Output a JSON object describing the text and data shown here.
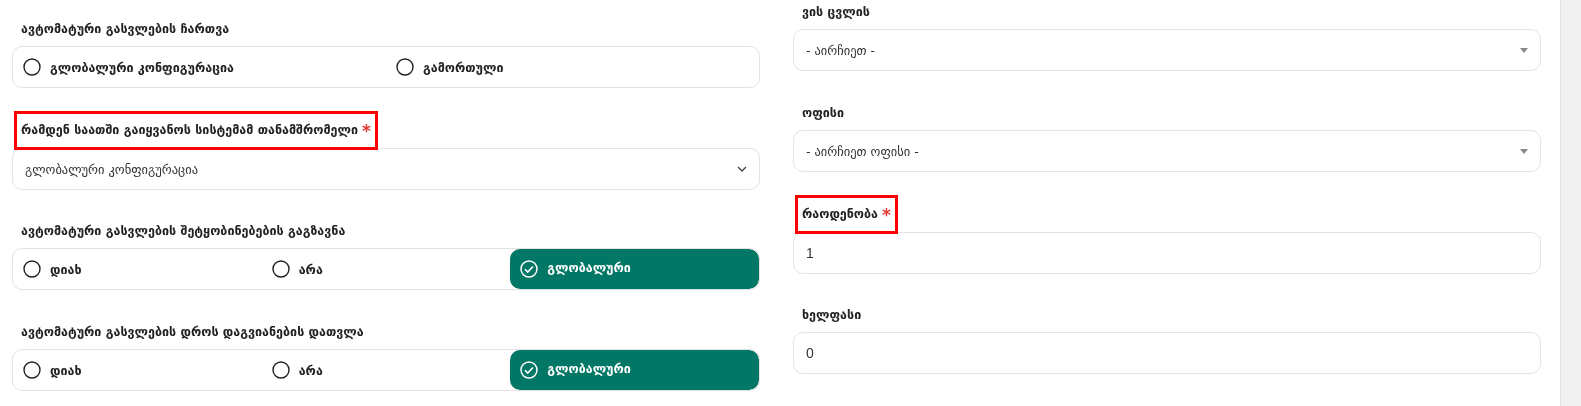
{
  "left_column": [
    {
      "kind": "radio",
      "label": "ავტომატური გასვლების ჩართვა",
      "highlighted": false,
      "options": [
        {
          "label": "გლობალური კონფიგურაცია",
          "selected": false
        },
        {
          "label": "გამორთული",
          "selected": false
        }
      ]
    },
    {
      "kind": "select",
      "label": "რამდენ საათში გაიყვანოს სისტემამ თანამშრომელი",
      "required_mark": "*",
      "highlighted": true,
      "value": "გლობალური კონფიგურაცია"
    },
    {
      "kind": "radio",
      "label": "ავტომატური გასვლების შეტყობინებების გაგზავნა",
      "highlighted": false,
      "options": [
        {
          "label": "დიახ",
          "selected": false
        },
        {
          "label": "არა",
          "selected": false
        },
        {
          "label": "გლობალური",
          "selected": true
        }
      ]
    },
    {
      "kind": "radio",
      "label": "ავტომატური გასვლების დროს დაგვიანების დათვლა",
      "highlighted": false,
      "options": [
        {
          "label": "დიახ",
          "selected": false
        },
        {
          "label": "არა",
          "selected": false
        },
        {
          "label": "გლობალური",
          "selected": true
        }
      ]
    }
  ],
  "right_column": [
    {
      "kind": "dropdown",
      "label": "ვის ცვლის",
      "highlighted": false,
      "value": "- აირჩიეთ -"
    },
    {
      "kind": "dropdown",
      "label": "ოფისი",
      "highlighted": false,
      "value": "- აირჩიეთ ოფისი -"
    },
    {
      "kind": "input",
      "label": "რაოდენობა",
      "required_mark": "*",
      "highlighted": true,
      "value": "1"
    },
    {
      "kind": "input",
      "label": "ხელფასი",
      "highlighted": false,
      "value": "0"
    }
  ]
}
